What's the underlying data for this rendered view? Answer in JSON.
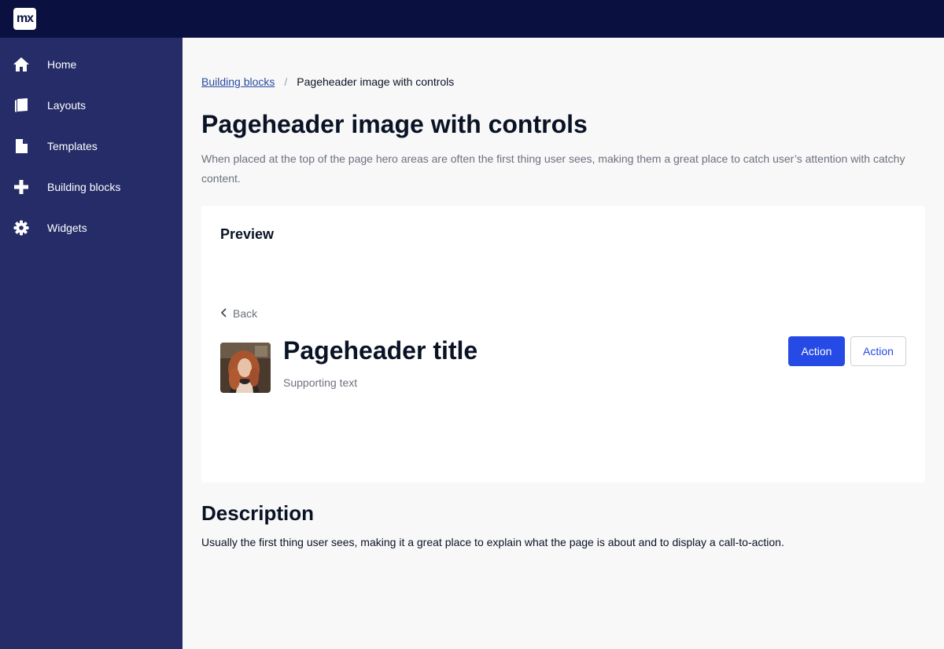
{
  "topbar": {
    "logo_text": "mx",
    "logo_icon": "mendix-logo-icon",
    "background": "#0a1141"
  },
  "sidebar": {
    "background": "#252c68",
    "items": [
      {
        "label": "Home",
        "icon": "home-icon"
      },
      {
        "label": "Layouts",
        "icon": "layouts-icon"
      },
      {
        "label": "Templates",
        "icon": "document-icon"
      },
      {
        "label": "Building blocks",
        "icon": "plus-icon"
      },
      {
        "label": "Widgets",
        "icon": "gear-icon"
      }
    ]
  },
  "breadcrumb": {
    "link": "Building blocks",
    "separator": "/",
    "current": "Pageheader image with controls"
  },
  "page": {
    "title": "Pageheader image with controls",
    "description": "When placed at the top of the page hero areas are often the first thing user sees, making them a great place to catch user’s attention with catchy content."
  },
  "preview": {
    "title": "Preview",
    "back_label": "Back",
    "header_title": "Pageheader title",
    "supporting_text": "Supporting text",
    "primary_action": "Action",
    "secondary_action": "Action",
    "accent": "#264ae5"
  },
  "description_section": {
    "title": "Description",
    "text": "Usually the first thing user sees, making it a great place to explain what the page is about and to display a call-to-action."
  }
}
